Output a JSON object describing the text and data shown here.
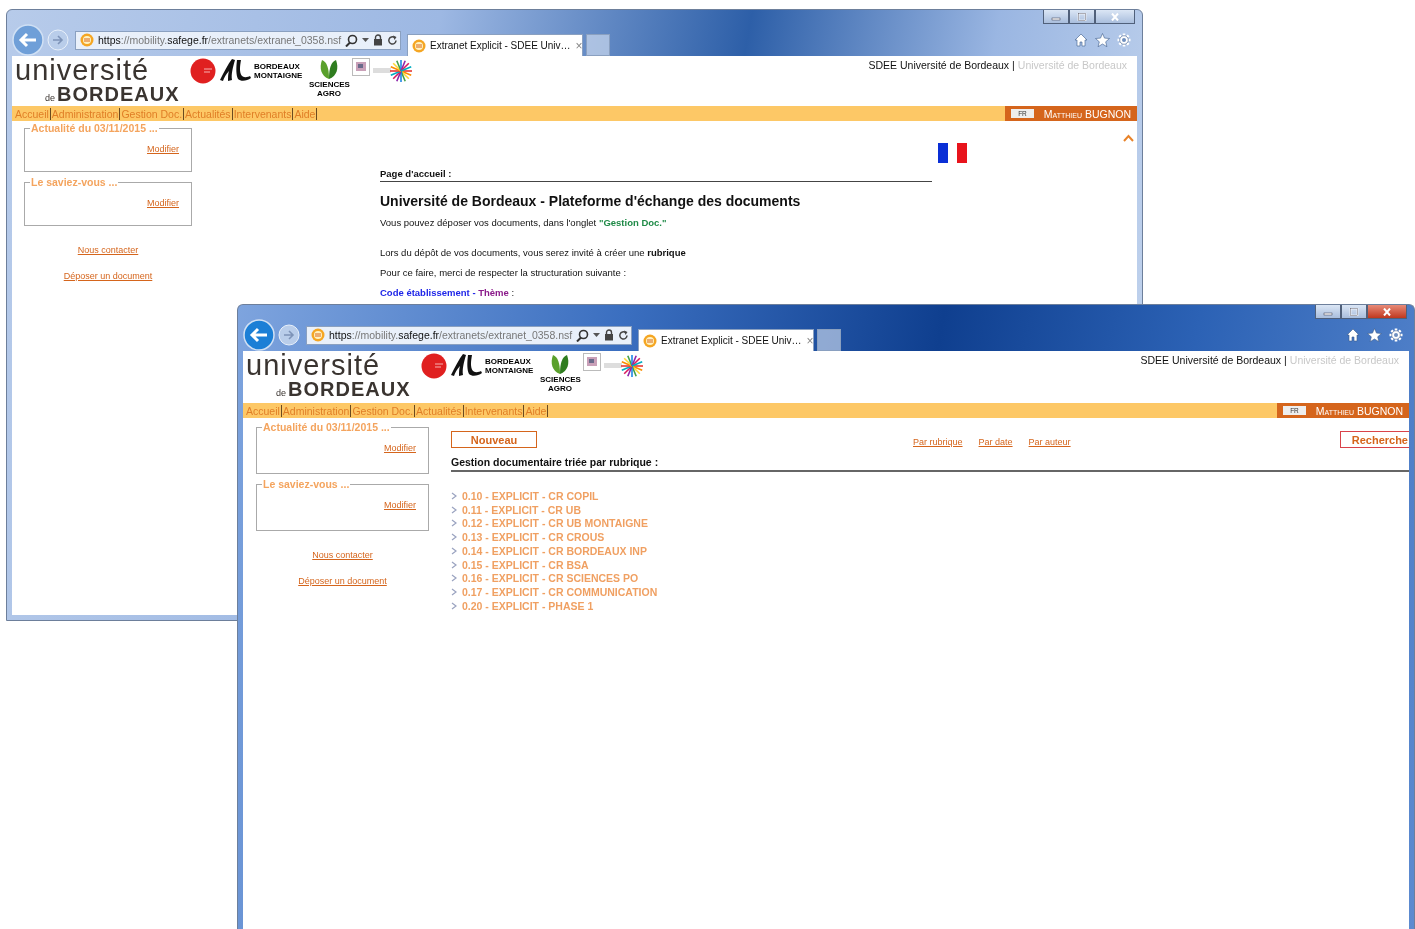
{
  "windows": [
    {
      "active": false,
      "address": "**https**://mobility.**safege.fr**/extranets/extranet_0358.nsf",
      "tab": {
        "title": "Extranet Explicit - SDEE Univ…",
        "close": "×"
      },
      "site": {
        "logo_top": "université",
        "logo_de": "de",
        "logo_bottom": "BORDEAUX",
        "partner_text": "BORDEAUX MONTAIGNE",
        "partner_text_2": "SCIENCES AGRO",
        "title": "SDEE Université de Bordeaux",
        "separator": "|",
        "subtitle": "Université de Bordeaux"
      },
      "nav": [
        "Accueil",
        "Administration",
        "Gestion Doc.",
        "Actualités",
        "Intervenants",
        "Aide"
      ],
      "lang": "FR",
      "user": "Matthieu BUGNON",
      "sidebar": {
        "boxes": [
          {
            "legend": "Actualité du 03/11/2015 ...",
            "link": "Modifier"
          },
          {
            "legend": "Le saviez-vous ...",
            "link": "Modifier"
          }
        ],
        "links": [
          "Nous contacter",
          "Déposer un document"
        ]
      },
      "content": {
        "kind": "home",
        "heading": "Page d'accueil :",
        "title": "Université de Bordeaux - Plateforme d'échange des documents",
        "paragraphs": [
          [
            {
              "kind": "plain",
              "text": "Vous pouvez déposer vos documents, dans l'onglet "
            },
            {
              "kind": "tab-name",
              "text": "\"Gestion Doc.\""
            }
          ],
          [
            {
              "kind": "plain",
              "text": "Lors du dépôt de vos documents, vous serez invité à créer une "
            },
            {
              "kind": "strong",
              "text": "rubrique"
            }
          ],
          [
            {
              "kind": "plain",
              "text": "Pour ce faire, merci de respecter la structuration suivante :"
            }
          ],
          [
            {
              "kind": "code",
              "text": "Code établissement - "
            },
            {
              "kind": "theme",
              "text": "Thème"
            },
            {
              "kind": "plain",
              "text": " :"
            }
          ]
        ]
      }
    },
    {
      "active": true,
      "address": "**https**://mobility.**safege.fr**/extranets/extranet_0358.nsf",
      "tab": {
        "title": "Extranet Explicit - SDEE Univ…",
        "close": "×"
      },
      "site": {
        "logo_top": "université",
        "logo_de": "de",
        "logo_bottom": "BORDEAUX",
        "partner_text": "BORDEAUX MONTAIGNE",
        "partner_text_2": "SCIENCES AGRO",
        "title": "SDEE Université de Bordeaux",
        "separator": "|",
        "subtitle": "Université de Bordeaux"
      },
      "nav": [
        "Accueil",
        "Administration",
        "Gestion Doc.",
        "Actualités",
        "Intervenants",
        "Aide"
      ],
      "lang": "FR",
      "user": "Matthieu BUGNON",
      "sidebar": {
        "boxes": [
          {
            "legend": "Actualité du 03/11/2015 ...",
            "link": "Modifier"
          },
          {
            "legend": "Le saviez-vous ...",
            "link": "Modifier"
          }
        ],
        "links": [
          "Nous contacter",
          "Déposer un document"
        ]
      },
      "content": {
        "kind": "documents",
        "new_button": "Nouveau",
        "sort_links": [
          "Par rubrique",
          "Par date",
          "Par auteur"
        ],
        "search_button": "Recherche",
        "heading": "Gestion documentaire triée par rubrique :",
        "categories": [
          "0.10 - EXPLICIT - CR COPIL",
          "0.11 - EXPLICIT - CR UB",
          "0.12 - EXPLICIT - CR UB MONTAIGNE",
          "0.13 - EXPLICIT - CR CROUS",
          "0.14 - EXPLICIT - CR BORDEAUX INP",
          "0.15 - EXPLICIT - CR BSA",
          "0.16 - EXPLICIT - CR SCIENCES PO",
          "0.17 - EXPLICIT - CR COMMUNICATION",
          "0.20 - EXPLICIT - PHASE 1"
        ]
      }
    }
  ]
}
